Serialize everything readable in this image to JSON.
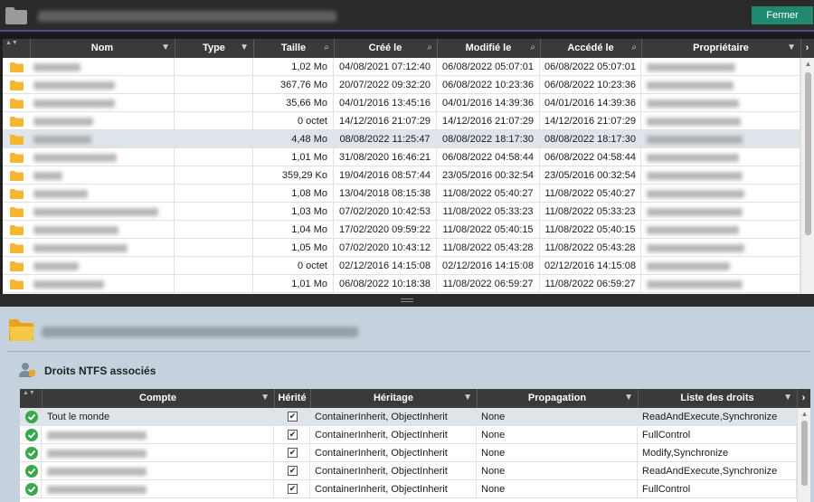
{
  "header": {
    "close_label": "Fermer"
  },
  "files_table": {
    "columns": [
      "Nom",
      "Type",
      "Taille",
      "Créé le",
      "Modifié le",
      "Accédé le",
      "Propriétaire"
    ],
    "rows": [
      {
        "size": "1,02 Mo",
        "created": "04/08/2021 07:12:40",
        "modified": "06/08/2022 05:07:01",
        "accessed": "06/08/2022 05:07:01"
      },
      {
        "size": "367,76 Mo",
        "created": "20/07/2022 09:32:20",
        "modified": "06/08/2022 10:23:36",
        "accessed": "06/08/2022 10:23:36"
      },
      {
        "size": "35,66 Mo",
        "created": "04/01/2016 13:45:16",
        "modified": "04/01/2016 14:39:36",
        "accessed": "04/01/2016 14:39:36"
      },
      {
        "size": "0 octet",
        "created": "14/12/2016 21:07:29",
        "modified": "14/12/2016 21:07:29",
        "accessed": "14/12/2016 21:07:29"
      },
      {
        "size": "4,48 Mo",
        "created": "08/08/2022 11:25:47",
        "modified": "08/08/2022 18:17:30",
        "accessed": "08/08/2022 18:17:30",
        "selected": true
      },
      {
        "size": "1,01 Mo",
        "created": "31/08/2020 16:46:21",
        "modified": "06/08/2022 04:58:44",
        "accessed": "06/08/2022 04:58:44"
      },
      {
        "size": "359,29 Ko",
        "created": "19/04/2016 08:57:44",
        "modified": "23/05/2016 00:32:54",
        "accessed": "23/05/2016 00:32:54"
      },
      {
        "size": "1,08 Mo",
        "created": "13/04/2018 08:15:38",
        "modified": "11/08/2022 05:40:27",
        "accessed": "11/08/2022 05:40:27"
      },
      {
        "size": "1,03 Mo",
        "created": "07/02/2020 10:42:53",
        "modified": "11/08/2022 05:33:23",
        "accessed": "11/08/2022 05:33:23"
      },
      {
        "size": "1,04 Mo",
        "created": "17/02/2020 09:59:22",
        "modified": "11/08/2022 05:40:15",
        "accessed": "11/08/2022 05:40:15"
      },
      {
        "size": "1,05 Mo",
        "created": "07/02/2020 10:43:12",
        "modified": "11/08/2022 05:43:28",
        "accessed": "11/08/2022 05:43:28"
      },
      {
        "size": "0 octet",
        "created": "02/12/2016 14:15:08",
        "modified": "02/12/2016 14:15:08",
        "accessed": "02/12/2016 14:15:08"
      },
      {
        "size": "1,01 Mo",
        "created": "06/08/2022 10:18:38",
        "modified": "11/08/2022 06:59:27",
        "accessed": "11/08/2022 06:59:27"
      }
    ]
  },
  "ntfs": {
    "title": "Droits NTFS associés",
    "columns": [
      "Compte",
      "Hérité",
      "Héritage",
      "Propagation",
      "Liste des droits"
    ],
    "rows": [
      {
        "account": "Tout le monde",
        "inherited": "✔",
        "inheritance": "ContainerInherit, ObjectInherit",
        "propagation": "None",
        "rights": "ReadAndExecute,Synchronize",
        "selected": true
      },
      {
        "account": "",
        "inherited": "✔",
        "inheritance": "ContainerInherit, ObjectInherit",
        "propagation": "None",
        "rights": "FullControl"
      },
      {
        "account": "",
        "inherited": "✔",
        "inheritance": "ContainerInherit, ObjectInherit",
        "propagation": "None",
        "rights": "Modify,Synchronize"
      },
      {
        "account": "",
        "inherited": "✔",
        "inheritance": "ContainerInherit, ObjectInherit",
        "propagation": "None",
        "rights": "ReadAndExecute,Synchronize"
      },
      {
        "account": "",
        "inherited": "✔",
        "inheritance": "ContainerInherit, ObjectInherit",
        "propagation": "None",
        "rights": "FullControl"
      }
    ]
  },
  "icons": {
    "folder": "folder-icon",
    "filter": "filter-icon",
    "search": "search-icon",
    "ok": "check-circle-icon",
    "user_key": "user-permission-icon"
  },
  "colors": {
    "accent_button": "#1f8a70",
    "header_bg": "#3a3a3a",
    "selected_row": "#dde4ea",
    "panel_bg": "#c5d2de",
    "folder_yellow": "#f5b731"
  }
}
